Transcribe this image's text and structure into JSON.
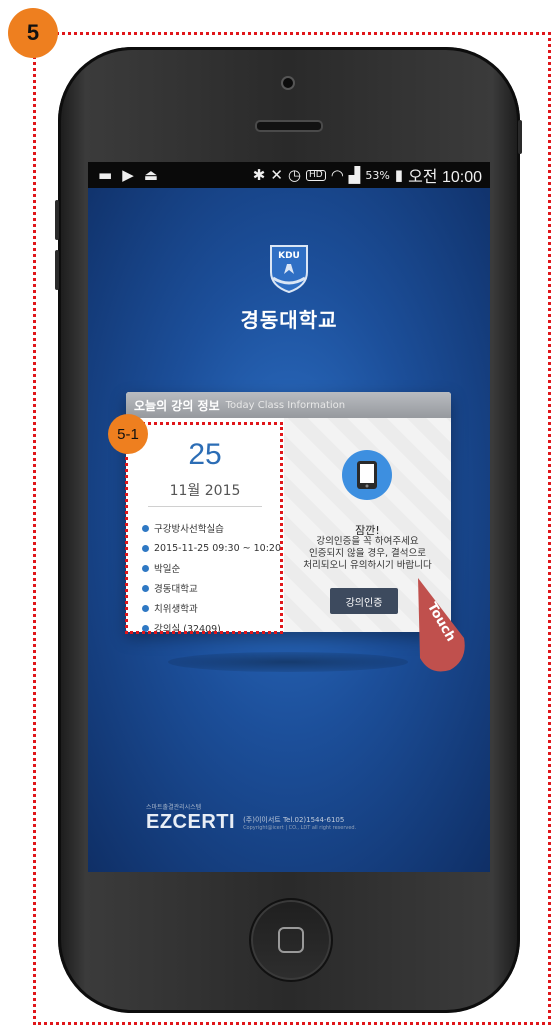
{
  "step_badge": "5",
  "sub_badge": "5-1",
  "status_bar": {
    "battery": "53%",
    "time": "오전 10:00",
    "icons": [
      "message-icon",
      "play-icon",
      "usb-icon",
      "bluetooth-icon",
      "mute-icon",
      "alarm-icon",
      "hd-icon",
      "wifi-icon",
      "signal-icon",
      "battery-icon"
    ]
  },
  "app": {
    "crest_text": "KDU",
    "university_name": "경동대학교"
  },
  "popup": {
    "title": "오늘의 강의 정보",
    "subtitle": "Today Class Information",
    "day": "25",
    "month_year": "11월 2015",
    "details": [
      "구강방사선학실습",
      "2015-11-25 09:30 ~ 10:20",
      "박일순",
      "경동대학교",
      "치위생학과",
      "강의실 (32409)"
    ],
    "notice_title": "잠깐!",
    "notice_lines": [
      "강의인증을 꼭 하여주세요",
      "인증되지 않을 경우, 결석으로",
      "처리되오니 유의하시기 바랍니다"
    ],
    "auth_button": "강의인증"
  },
  "touch_label": "Touch",
  "footer": {
    "brand_small": "스마트출결관리시스템",
    "brand": "EZCERTI",
    "company": "(주)이이서트 Tel.02)1544-6105",
    "copyright": "Copyright@icert | CO., LDT all right reserved."
  },
  "colors": {
    "annotation_red": "#e0161a",
    "badge_orange": "#ee7f1f",
    "screen_blue": "#1c4f9a",
    "accent_blue": "#2f79c4",
    "touch_marker": "#c0504d"
  }
}
